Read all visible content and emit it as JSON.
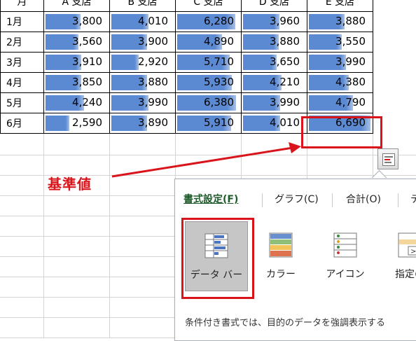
{
  "sheet": {
    "headers": [
      "月",
      "A 支店",
      "B 支店",
      "C 支店",
      "D 支店",
      "E 支店"
    ],
    "rows": [
      {
        "label": "1月",
        "values": [
          "3,800",
          "4,010",
          "6,280",
          "3,960",
          "3,880"
        ],
        "fill": [
          0.57,
          0.6,
          0.94,
          0.59,
          0.58
        ]
      },
      {
        "label": "2月",
        "values": [
          "3,560",
          "3,900",
          "4,890",
          "3,880",
          "3,550"
        ],
        "fill": [
          0.53,
          0.58,
          0.73,
          0.58,
          0.53
        ]
      },
      {
        "label": "3月",
        "values": [
          "3,910",
          "2,920",
          "5,710",
          "3,650",
          "3,990"
        ],
        "fill": [
          0.58,
          0.44,
          0.85,
          0.55,
          0.6
        ]
      },
      {
        "label": "4月",
        "values": [
          "3,850",
          "3,880",
          "5,930",
          "4,210",
          "4,380"
        ],
        "fill": [
          0.58,
          0.58,
          0.89,
          0.63,
          0.65
        ]
      },
      {
        "label": "5月",
        "values": [
          "4,240",
          "3,990",
          "6,380",
          "3,990",
          "4,790"
        ],
        "fill": [
          0.63,
          0.6,
          0.95,
          0.6,
          0.72
        ]
      },
      {
        "label": "6月",
        "values": [
          "2,590",
          "3,890",
          "5,910",
          "4,010",
          "6,690"
        ],
        "fill": [
          0.39,
          0.58,
          0.88,
          0.6,
          1.0
        ]
      }
    ]
  },
  "annotation": {
    "label": "基準値"
  },
  "quick_analysis": {
    "icon": "quick-analysis-icon",
    "tabs": [
      "書式設定(F)",
      "グラフ(C)",
      "合計(O)",
      "テ"
    ],
    "active_tab": "書式設定(F)",
    "options": [
      {
        "label": "データ バー",
        "icon": "data-bar-icon",
        "selected": true
      },
      {
        "label": "カラー",
        "icon": "color-scale-icon",
        "selected": false
      },
      {
        "label": "アイコン",
        "icon": "icon-set-icon",
        "selected": false
      },
      {
        "label": "指定の",
        "icon": "greater-than-icon",
        "selected": false
      }
    ],
    "description": "条件付き書式では、目的のデータを強調表示する"
  },
  "colors": {
    "bar": "#5b8ad2",
    "highlight": "#d9141b"
  }
}
